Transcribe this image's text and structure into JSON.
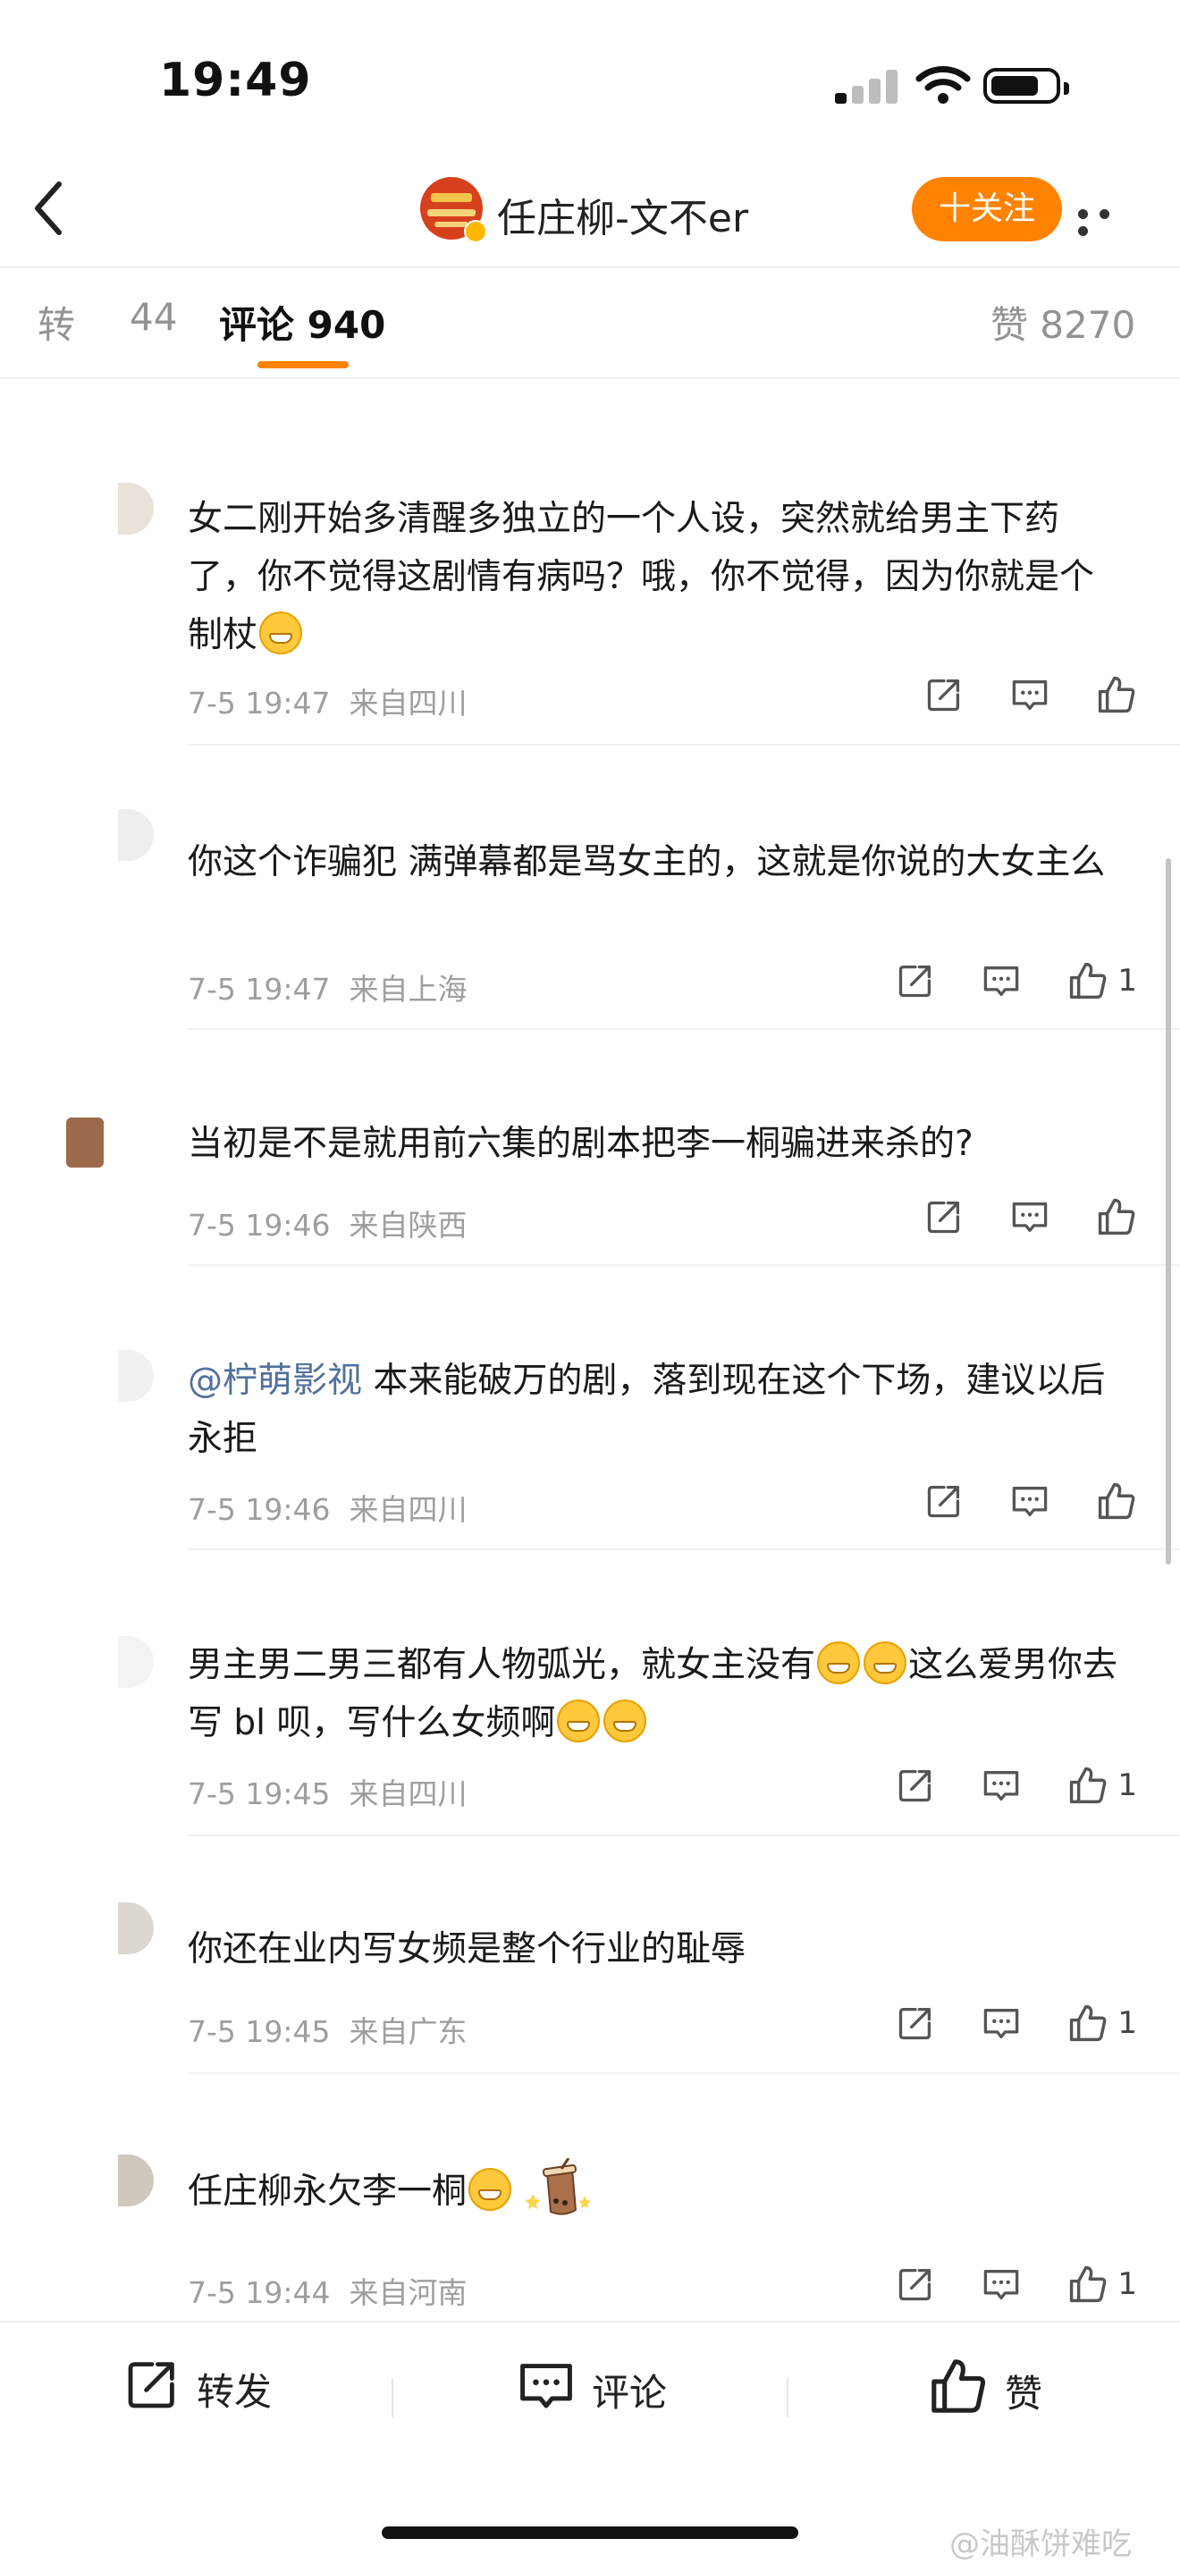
{
  "status_bar": {
    "time": "19:49"
  },
  "header": {
    "title": "任庄柳-文不er",
    "follow_label": "十关注"
  },
  "tabs": {
    "repost_label": "转",
    "repost_count": "44",
    "comments": "评论 940",
    "likes": "赞 8270"
  },
  "comments": [
    {
      "text": "女二刚开始多清醒多独立的一个人设，突然就给男主下药了，你不觉得这剧情有病吗？哦，你不觉得，因为你就是个制杖",
      "emoji_count": 1,
      "time": "7-5 19:47",
      "location": "来自四川",
      "likes": ""
    },
    {
      "text": "你这个诈骗犯 满弹幕都是骂女主的，这就是你说的大女主么",
      "time": "7-5 19:47",
      "location": "来自上海",
      "likes": "1"
    },
    {
      "text": "当初是不是就用前六集的剧本把李一桐骗进来杀的?",
      "time": "7-5 19:46",
      "location": "来自陕西",
      "likes": ""
    },
    {
      "mention": "@柠萌影视",
      "text": " 本来能破万的剧，落到现在这个下场，建议以后永拒",
      "time": "7-5 19:46",
      "location": "来自四川",
      "likes": ""
    },
    {
      "text_a": "男主男二男三都有人物弧光，就女主没有",
      "text_b": "这么爱男你去写 bl 呗，写什么女频啊",
      "time": "7-5 19:45",
      "location": "来自四川",
      "likes": "1"
    },
    {
      "text": "你还在业内写女频是整个行业的耻辱",
      "time": "7-5 19:45",
      "location": "来自广东",
      "likes": "1"
    },
    {
      "text": "任庄柳永欠李一桐",
      "time": "7-5 19:44",
      "location": "来自河南",
      "likes": "1"
    }
  ],
  "bottom_bar": {
    "repost": "转发",
    "comment": "评论",
    "like": "赞"
  },
  "watermark": "@油酥饼难吃",
  "colors": {
    "accent": "#ff8200",
    "mention": "#50719e",
    "meta": "#9e9e9e"
  },
  "icons": [
    "back-icon",
    "more-icon",
    "share-icon",
    "comment-icon",
    "like-icon",
    "grin-emoji-icon",
    "sticker-icon"
  ]
}
